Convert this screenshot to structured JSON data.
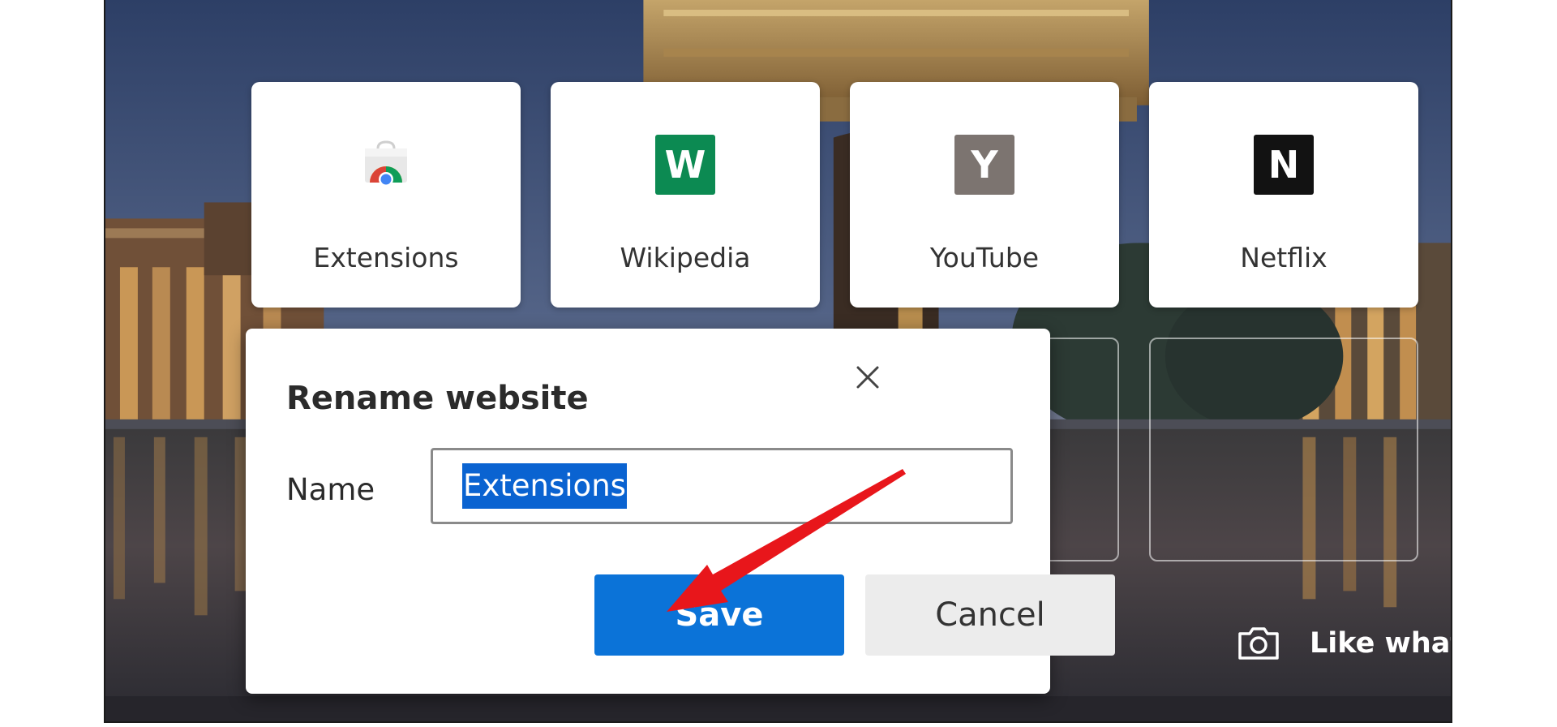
{
  "top_sites": [
    {
      "label": "Extensions",
      "icon": "chrome-web-store-icon"
    },
    {
      "label": "Wikipedia",
      "icon": "wikipedia-letter-icon",
      "letter": "W",
      "color": "#0c8a52"
    },
    {
      "label": "YouTube",
      "icon": "youtube-letter-icon",
      "letter": "Y",
      "color": "#7c7470"
    },
    {
      "label": "Netflix",
      "icon": "netflix-letter-icon",
      "letter": "N",
      "color": "#121212"
    }
  ],
  "background": {
    "caption": "Like what"
  },
  "dialog": {
    "title": "Rename website",
    "name_label": "Name",
    "name_value": "Extensions",
    "save_label": "Save",
    "cancel_label": "Cancel"
  },
  "colors": {
    "accent": "#0b73d8",
    "annotation_arrow": "#e8161b"
  }
}
